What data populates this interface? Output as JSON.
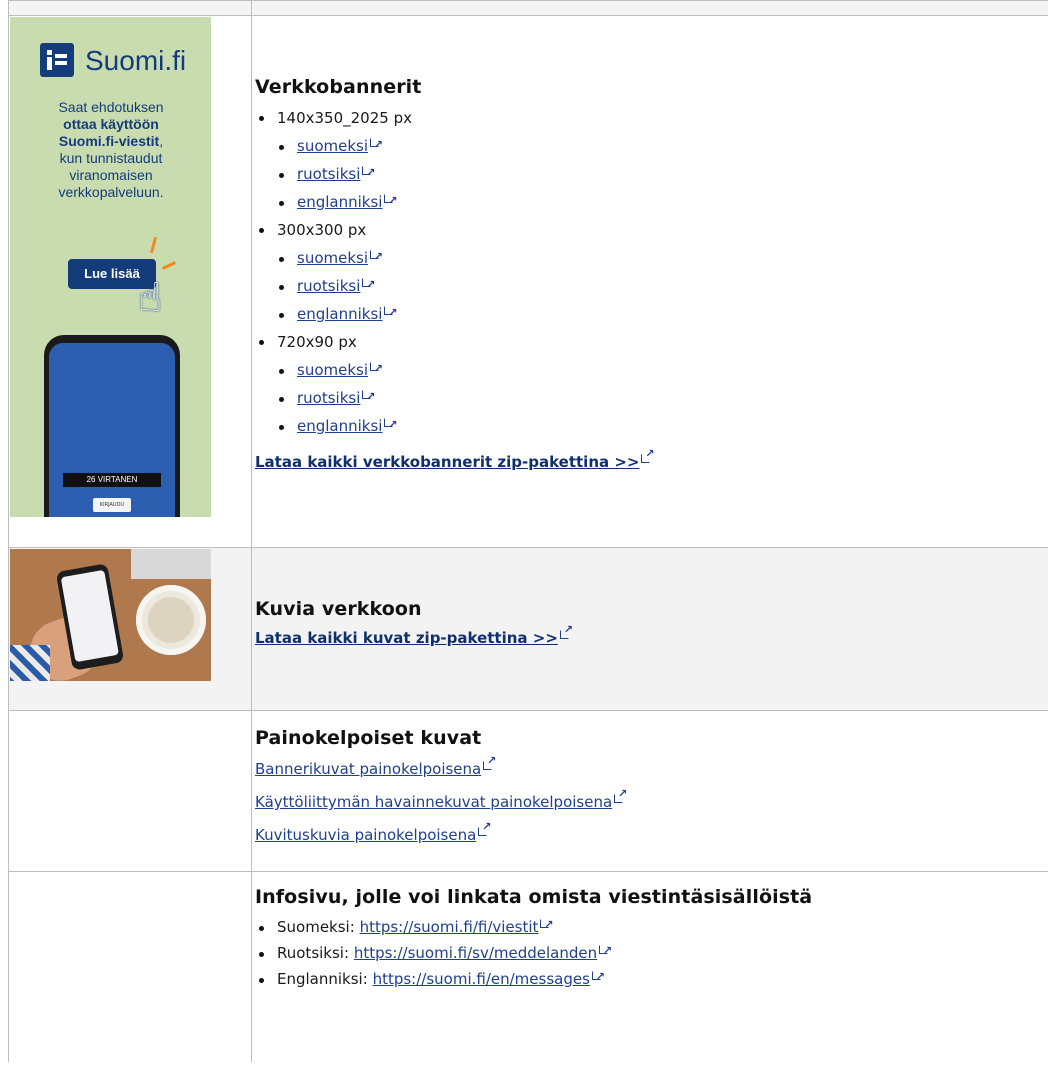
{
  "banner": {
    "brand": "Suomi.fi",
    "line1": "Saat ehdotuksen",
    "line2": "ottaa käyttöön",
    "line3": "Suomi.fi-viestit",
    "line3_suffix": ",",
    "line4": "kun tunnistaudut",
    "line5": "viranomaisen",
    "line6": "verkkopalveluun.",
    "button": "Lue lisää",
    "phone_bar": "26 VIRTANEN",
    "phone_button": "KIRJAUDU"
  },
  "section1": {
    "title": "Verkkobannerit",
    "groups": [
      {
        "label": "140x350_2025 px",
        "links": [
          "suomeksi",
          "ruotsiksi",
          "englanniksi"
        ]
      },
      {
        "label": "300x300 px",
        "links": [
          "suomeksi",
          "ruotsiksi",
          "englanniksi"
        ]
      },
      {
        "label": "720x90 px",
        "links": [
          "suomeksi",
          "ruotsiksi",
          "englanniksi"
        ]
      }
    ],
    "zip_link": "Lataa kaikki verkkobannerit zip-pakettina >>"
  },
  "section2": {
    "title": "Kuvia verkkoon",
    "zip_link": "Lataa kaikki kuvat zip-pakettina >>"
  },
  "section3": {
    "title": "Painokelpoiset kuvat",
    "links": [
      "Bannerikuvat painokelpoisena",
      "Käyttöliittymän havainnekuvat painokelpoisena",
      "Kuvituskuvia painokelpoisena"
    ]
  },
  "section4": {
    "title": "Infosivu, jolle voi linkata omista viestintäsisällöistä",
    "items": [
      {
        "label": "Suomeksi:",
        "url": "https://suomi.fi/fi/viestit"
      },
      {
        "label": "Ruotsiksi:",
        "url": "https://suomi.fi/sv/meddelanden"
      },
      {
        "label": "Englanniksi:",
        "url": "https://suomi.fi/en/messages"
      }
    ]
  }
}
